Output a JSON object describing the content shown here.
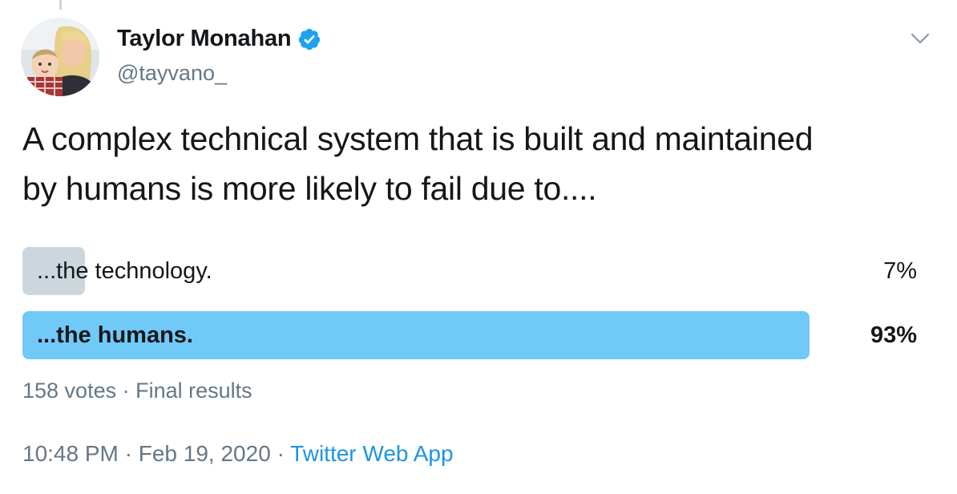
{
  "tweet": {
    "author": {
      "display_name": "Taylor Monahan",
      "handle": "@tayvano_",
      "verified": true,
      "verified_icon": "verified-badge-icon",
      "avatar_icon": "profile-avatar"
    },
    "text_line1": "A complex technical system that is built and maintained",
    "text_line2": "by humans is more likely to fail due to....",
    "poll": {
      "options": [
        {
          "label": "...the technology.",
          "percent_text": "7%",
          "percent": 7,
          "winner": false
        },
        {
          "label": "...the humans.",
          "percent_text": "93%",
          "percent": 93,
          "winner": true
        }
      ],
      "votes": "158 votes",
      "separator": "·",
      "status": "Final results"
    },
    "time": "10:48 PM",
    "date": "Feb 19, 2020",
    "source": "Twitter Web App",
    "separator": "·"
  },
  "colors": {
    "winner_bar": "#71c9f8",
    "loser_bar": "#ccd6dd",
    "link": "#1b95e0",
    "verified": "#1da1f2",
    "muted": "#657786"
  },
  "icons": {
    "more_menu": "chevron-down-icon"
  }
}
